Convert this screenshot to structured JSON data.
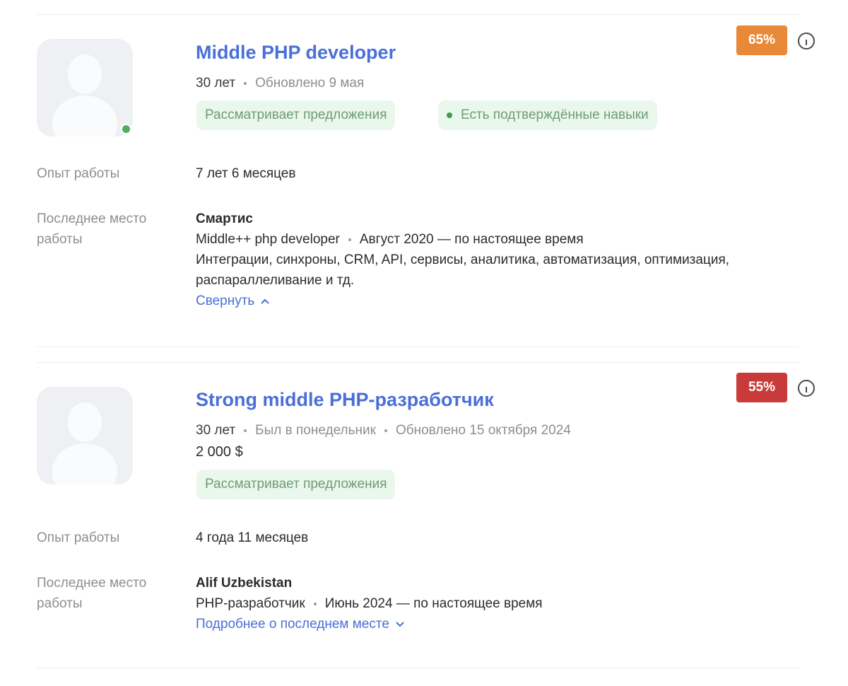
{
  "colors": {
    "title_link": "#4a6fd8",
    "badge_high": "#e8893a",
    "badge_mid": "#c93a3a",
    "chip_bg": "#eaf7ec",
    "online": "#4caf62"
  },
  "cards": [
    {
      "title": "Middle PHP developer",
      "age": "30 лет",
      "updated": "Обновлено 9 мая",
      "online": true,
      "chips": [
        "Рассматривает предложения",
        "Есть подтверждённые навыки"
      ],
      "match_percent": "65%",
      "experience_label": "Опыт работы",
      "experience_value": "7 лет 6 месяцев",
      "last_job_label": "Последнее место работы",
      "company": "Смартис",
      "position": "Middle++ php developer",
      "period": "Август 2020 — по настоящее время",
      "description": "Интеграции, синхроны, CRM, API, сервисы, аналитика, автоматизация, оптимизация, распараллеливание и тд.",
      "toggle_label": "Свернуть"
    },
    {
      "title": "Strong middle PHP-разработчик",
      "age": "30 лет",
      "last_seen": "Был в понедельник",
      "updated": "Обновлено 15 октября 2024",
      "salary": "2 000 $",
      "chips": [
        "Рассматривает предложения"
      ],
      "match_percent": "55%",
      "experience_label": "Опыт работы",
      "experience_value": "4 года 11 месяцев",
      "last_job_label": "Последнее место работы",
      "company": "Alif Uzbekistan",
      "position": "PHP-разработчик",
      "period": "Июнь 2024 — по настоящее время",
      "toggle_label": "Подробнее о последнем месте"
    }
  ]
}
